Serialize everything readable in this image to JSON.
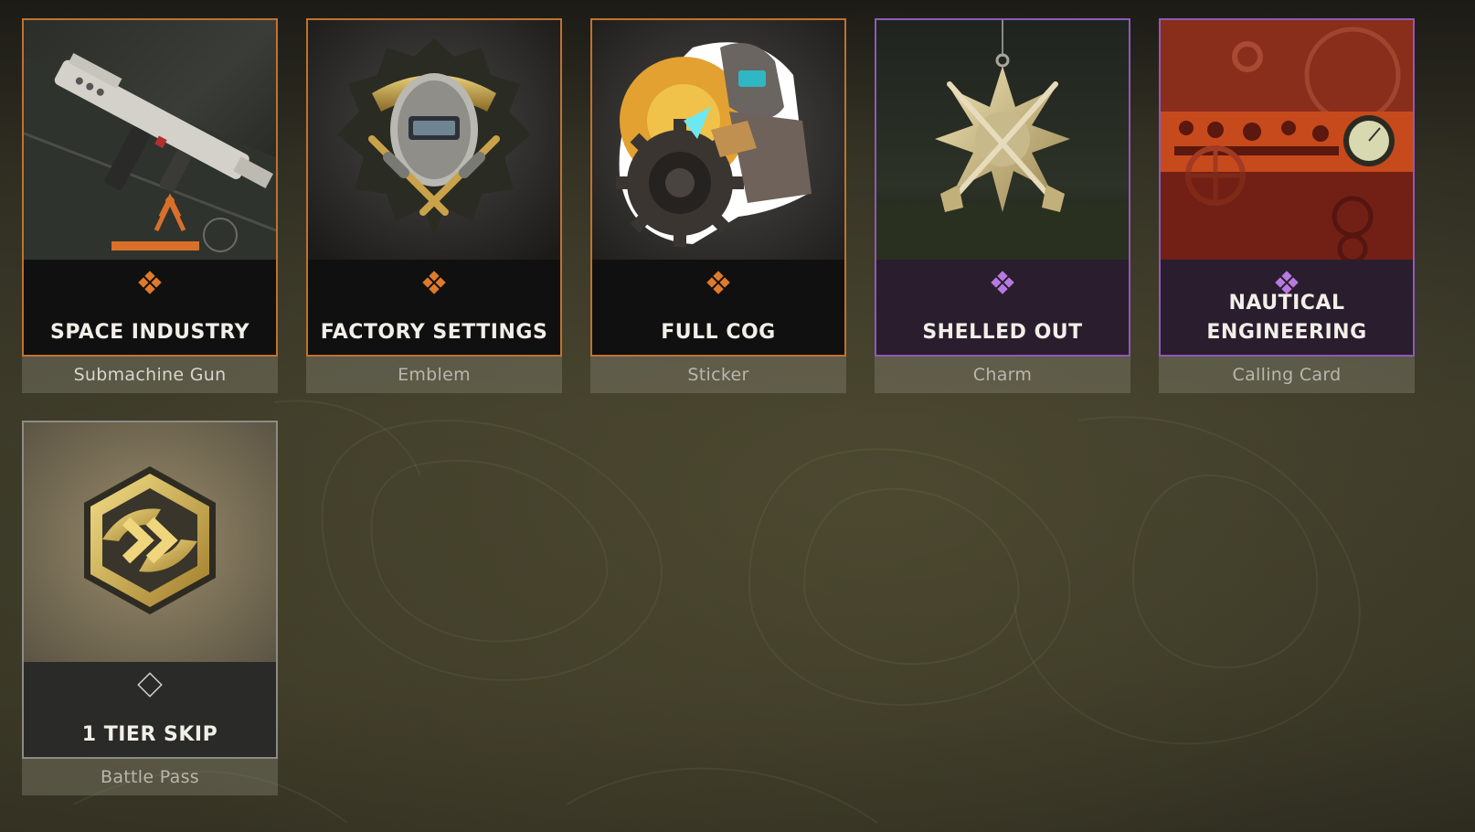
{
  "colors": {
    "legendary": "#c0722f",
    "epic": "#8d5ab8",
    "common": "#8b8b86"
  },
  "rewards": [
    {
      "name": "SPACE INDUSTRY",
      "type": "Submachine Gun",
      "rarity": "legendary",
      "icon": "smg-weapon-blueprint"
    },
    {
      "name": "FACTORY SETTINGS",
      "type": "Emblem",
      "rarity": "legendary",
      "icon": "welder-mask-emblem"
    },
    {
      "name": "FULL COG",
      "type": "Sticker",
      "rarity": "legendary",
      "icon": "welder-cog-sticker"
    },
    {
      "name": "SHELLED OUT",
      "type": "Charm",
      "rarity": "epic",
      "icon": "crossed-shotguns-charm"
    },
    {
      "name": "NAUTICAL ENGINEERING",
      "type": "Calling Card",
      "rarity": "epic",
      "icon": "ship-gauges-calling-card"
    },
    {
      "name": "1 TIER SKIP",
      "type": "Battle Pass",
      "rarity": "common",
      "icon": "tier-skip-hexagon"
    }
  ]
}
